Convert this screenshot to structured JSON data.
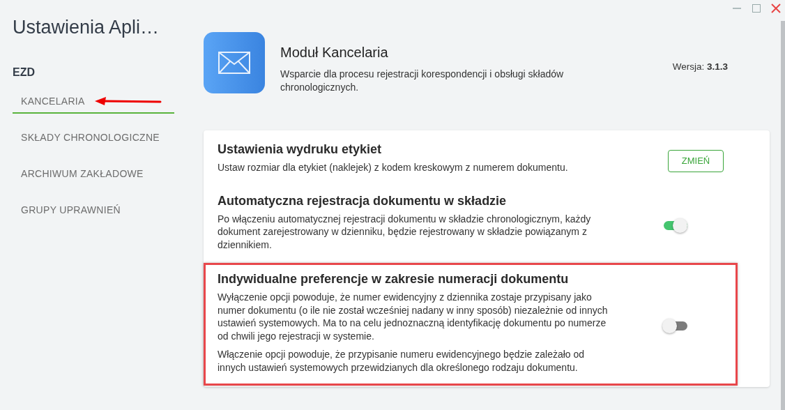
{
  "sidebar": {
    "title": "Ustawienia Apli…",
    "section": "EZD",
    "items": [
      {
        "label": "KANCELARIA",
        "selected": true,
        "annotated": true
      },
      {
        "label": "SKŁADY CHRONOLOGICZNE",
        "selected": false,
        "annotated": false
      },
      {
        "label": "ARCHIWUM ZAKŁADOWE",
        "selected": false,
        "annotated": false
      },
      {
        "label": "GRUPY UPRAWNIEŃ",
        "selected": false,
        "annotated": false
      }
    ]
  },
  "module": {
    "title": "Moduł Kancelaria",
    "description": "Wsparcie dla procesu rejestracji korespondencji i obsługi składów chronologicznych.",
    "version_label": "Wersja:",
    "version": "3.1.3"
  },
  "settings": [
    {
      "kind": "button",
      "title": "Ustawienia wydruku etykiet",
      "paragraphs": [
        "Ustaw rozmiar dla etykiet (naklejek) z kodem kreskowym z numerem dokumentu."
      ],
      "button": "ZMIEŃ",
      "highlighted": false
    },
    {
      "kind": "toggle",
      "title": "Automatyczna rejestracja dokumentu w składzie",
      "paragraphs": [
        "Po włączeniu automatycznej rejestracji dokumentu w składzie chronologicznym, każdy dokument zarejestrowany w dzienniku, będzie rejestrowany w składzie powiązanym z dziennikiem."
      ],
      "on": true,
      "highlighted": false
    },
    {
      "kind": "toggle",
      "title": "Indywidualne preferencje w zakresie numeracji dokumentu",
      "paragraphs": [
        "Wyłączenie opcji powoduje, że numer ewidencyjny z dziennika zostaje przypisany jako numer dokumentu (o ile nie został wcześniej nadany w inny sposób) niezależnie od innych ustawień systemowych. Ma to na celu jednoznaczną identyfikację dokumentu po numerze od chwili jego rejestracji w systemie.",
        "Włączenie opcji powoduje, że przypisanie numeru ewidencyjnego będzie zależało od innych ustawień systemowych przewidzianych dla określonego rodzaju dokumentu."
      ],
      "on": false,
      "highlighted": true
    }
  ]
}
